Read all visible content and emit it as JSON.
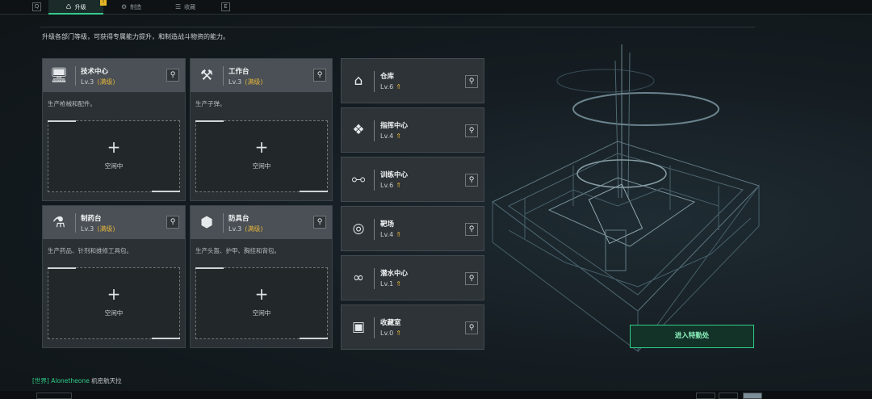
{
  "topbar": {
    "left_key": "Q",
    "right_key": "E",
    "tabs": [
      {
        "label": "升级",
        "active": true,
        "badge": "!"
      },
      {
        "label": "制造",
        "active": false
      },
      {
        "label": "收藏",
        "active": false
      }
    ]
  },
  "description": "升级各部门等级，可获得专属能力提升，和制造战斗物资的能力。",
  "workshops": [
    {
      "name": "技术中心",
      "level": "Lv.3",
      "max_label": "(满级)",
      "desc": "生产枪械和配件。",
      "slot_label": "空闲中",
      "icon": "computer-icon"
    },
    {
      "name": "工作台",
      "level": "Lv.3",
      "max_label": "(满级)",
      "desc": "生产子弹。",
      "slot_label": "空闲中",
      "icon": "tools-icon"
    },
    {
      "name": "制药台",
      "level": "Lv.3",
      "max_label": "(满级)",
      "desc": "生产药品、针剂和维修工具包。",
      "slot_label": "空闲中",
      "icon": "microscope-icon"
    },
    {
      "name": "防具台",
      "level": "Lv.3",
      "max_label": "(满级)",
      "desc": "生产头盔、护甲、胸挂和背包。",
      "slot_label": "空闲中",
      "icon": "armor-parts-icon"
    }
  ],
  "facilities": [
    {
      "name": "仓库",
      "level": "Lv.6",
      "icon": "warehouse-icon"
    },
    {
      "name": "指挥中心",
      "level": "Lv.4",
      "icon": "command-icon"
    },
    {
      "name": "训练中心",
      "level": "Lv.6",
      "icon": "dumbbell-icon"
    },
    {
      "name": "靶场",
      "level": "Lv.4",
      "icon": "target-icon"
    },
    {
      "name": "潜水中心",
      "level": "Lv.1",
      "icon": "diving-mask-icon"
    },
    {
      "name": "收藏室",
      "level": "Lv.0",
      "icon": "collection-icon"
    }
  ],
  "enter_button": "进入特勤处",
  "chat": {
    "channel": "[世界]",
    "user": "Alonetheone",
    "message": "机密航天拉"
  },
  "colors": {
    "accent": "#2fcf86",
    "max_level": "#e2b23c",
    "badge": "#e6b523"
  }
}
